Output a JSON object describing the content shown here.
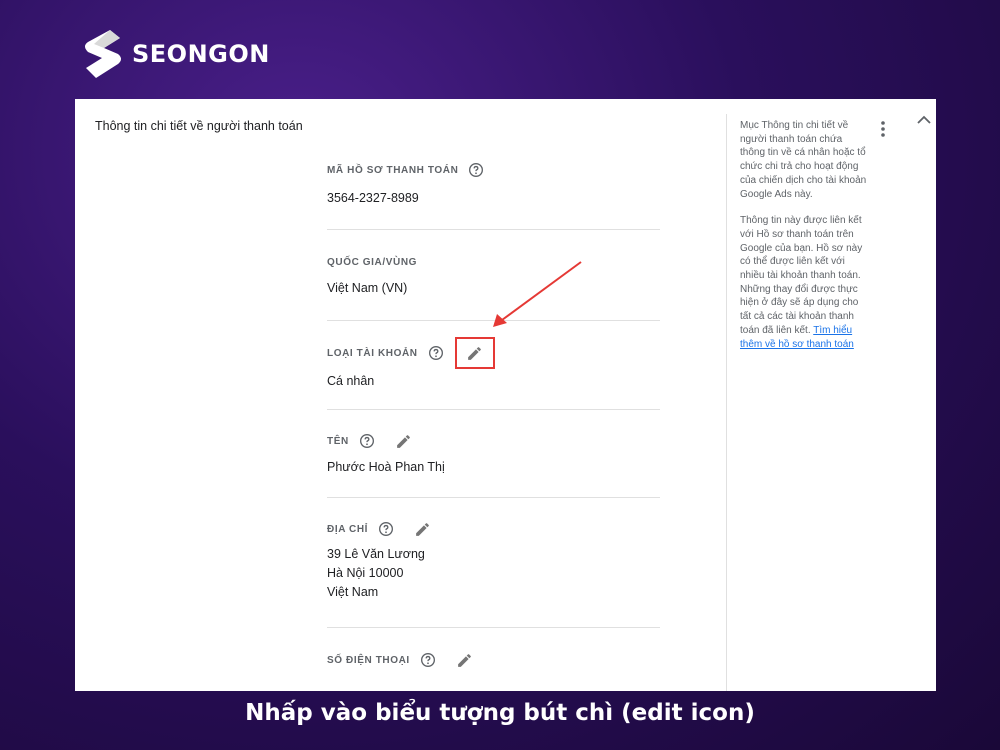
{
  "brand": {
    "name": "SEONGON"
  },
  "section": {
    "title": "Thông tin chi tiết về người thanh toán"
  },
  "fields": [
    {
      "label": "MÃ HỒ SƠ THANH TOÁN",
      "value": "3564-2327-8989"
    },
    {
      "label": "QUỐC GIA/VÙNG",
      "value": "Việt Nam (VN)"
    },
    {
      "label": "LOẠI TÀI KHOẢN",
      "value": "Cá nhân"
    },
    {
      "label": "TÊN",
      "value": "Phước Hoà Phan Thị"
    },
    {
      "label": "ĐỊA CHỈ",
      "value_lines": [
        "39 Lê Văn Lương",
        "Hà Nội 10000",
        "Việt Nam"
      ]
    },
    {
      "label": "SỐ ĐIỆN THOẠI"
    }
  ],
  "side_help": {
    "paragraph1": "Mục Thông tin chi tiết về người thanh toán chứa thông tin về cá nhân hoặc tổ chức chi trả cho hoạt động của chiến dịch cho tài khoản Google Ads này.",
    "paragraph2": "Thông tin này được liên kết với Hồ sơ thanh toán trên Google của bạn. Hồ sơ này có thể được liên kết với nhiều tài khoản thanh toán. Những thay đổi được thực hiện ở đây sẽ áp dụng cho tất cả các tài khoản thanh toán đã liên kết.",
    "link": "Tìm hiểu thêm về hồ sơ thanh toán"
  },
  "icons": {
    "help": "help-circle-icon",
    "edit": "pencil-icon",
    "more": "more-vertical-icon",
    "collapse": "chevron-up-icon"
  },
  "colors": {
    "highlight": "#e53935",
    "link": "#1a73e8",
    "brand_bg": "#2a0f5c"
  },
  "caption": "Nhấp vào biểu tượng bút chì (edit icon)"
}
